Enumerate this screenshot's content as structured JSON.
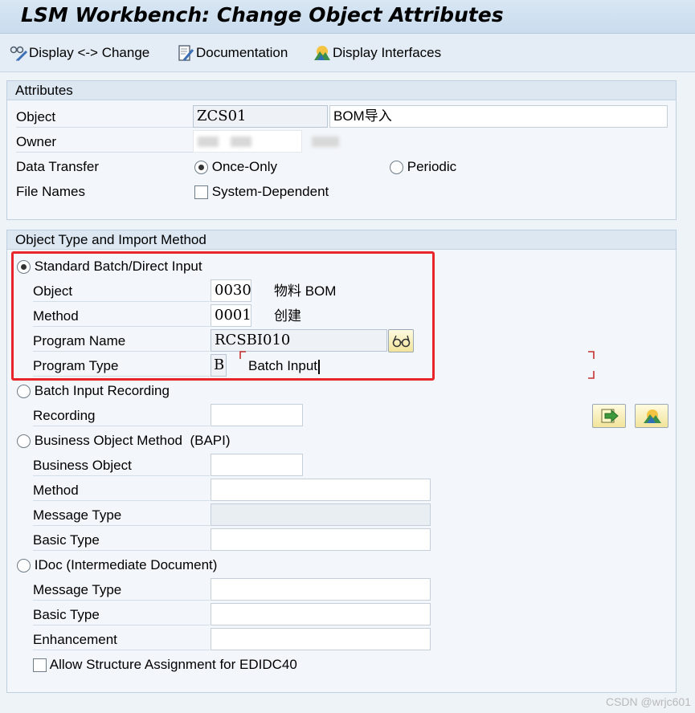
{
  "window": {
    "title": "LSM Workbench: Change Object Attributes"
  },
  "toolbar": {
    "display_change": "Display <-> Change",
    "documentation": "Documentation",
    "display_interfaces": "Display Interfaces"
  },
  "attributes": {
    "header": "Attributes",
    "object_label": "Object",
    "object_value": "ZCS01",
    "object_desc": "BOM导入",
    "owner_label": "Owner",
    "data_transfer_label": "Data Transfer",
    "once_only": "Once-Only",
    "periodic": "Periodic",
    "file_names_label": "File Names",
    "system_dependent": "System-Dependent"
  },
  "import_method": {
    "header": "Object Type and Import Method",
    "standard": {
      "label": "Standard Batch/Direct Input",
      "object_label": "Object",
      "object_value": "0030",
      "object_desc": "物料 BOM",
      "method_label": "Method",
      "method_value": "0001",
      "method_desc": "创建",
      "program_name_label": "Program Name",
      "program_name_value": "RCSBI010",
      "program_type_label": "Program Type",
      "program_type_value": "B",
      "program_type_desc": "Batch Input"
    },
    "recording": {
      "label": "Batch Input Recording",
      "recording_label": "Recording"
    },
    "bapi": {
      "label": "Business Object Method  (BAPI)",
      "business_object_label": "Business Object",
      "method_label": "Method",
      "message_type_label": "Message Type",
      "basic_type_label": "Basic Type"
    },
    "idoc": {
      "label": "IDoc (Intermediate Document)",
      "message_type_label": "Message Type",
      "basic_type_label": "Basic Type",
      "enhancement_label": "Enhancement",
      "allow_structure": "Allow Structure Assignment for EDIDC40"
    }
  },
  "watermark": "CSDN @wrjc601"
}
